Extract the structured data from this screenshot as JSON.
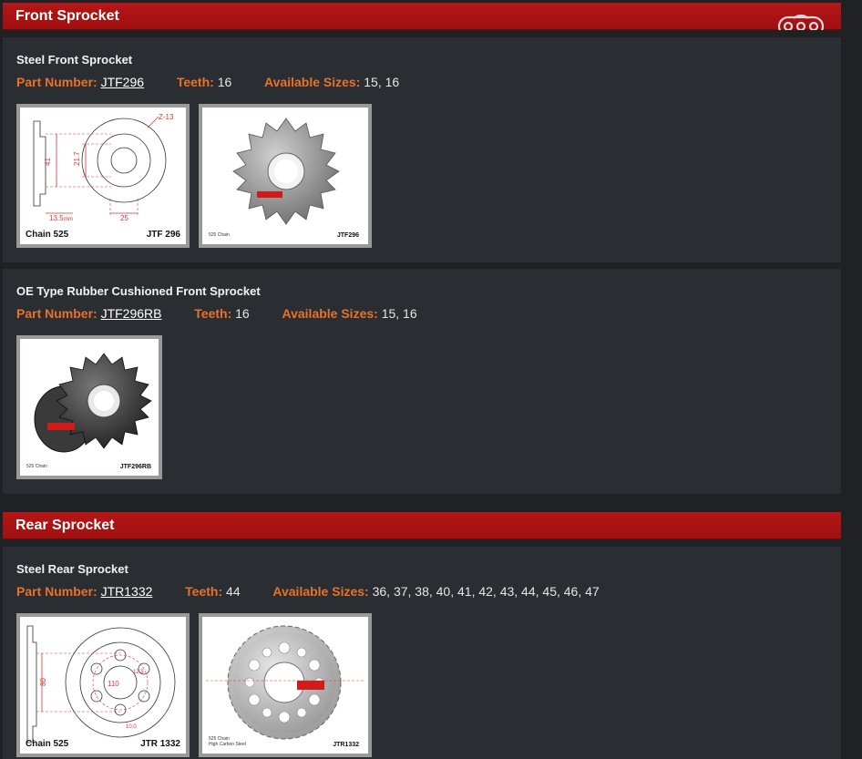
{
  "sections": {
    "front": {
      "title": "Front Sprocket",
      "products": [
        {
          "name": "Steel Front Sprocket",
          "part_label": "Part Number:",
          "part_number": "JTF296",
          "teeth_label": "Teeth:",
          "teeth": "16",
          "sizes_label": "Available Sizes:",
          "sizes": "15, 16",
          "diagram": {
            "chain": "Chain 525",
            "code": "JTF 296",
            "z": "Z-13",
            "d1": "41",
            "d2": "21.7",
            "d3": "13.5",
            "d4": "25",
            "unit": "mm"
          },
          "photo": {
            "chain": "525 Chain",
            "code": "JTF296"
          }
        },
        {
          "name": "OE Type Rubber Cushioned Front Sprocket",
          "part_label": "Part Number:",
          "part_number": "JTF296RB",
          "teeth_label": "Teeth:",
          "teeth": "16",
          "sizes_label": "Available Sizes:",
          "sizes": "15, 16",
          "photo": {
            "chain": "525 Chain",
            "code": "JTF296RB"
          }
        }
      ]
    },
    "rear": {
      "title": "Rear Sprocket",
      "products": [
        {
          "name": "Steel Rear Sprocket",
          "part_label": "Part Number:",
          "part_number": "JTR1332",
          "teeth_label": "Teeth:",
          "teeth": "44",
          "sizes_label": "Available Sizes:",
          "sizes": "36, 37, 38, 40, 41, 42, 43, 44, 45, 46, 47",
          "diagram": {
            "chain": "Chain 525",
            "code": "JTR 1332",
            "d1": "80",
            "d2": "110",
            "d3": "12.5",
            "d4": "10.0",
            "unit": "mm"
          },
          "photo": {
            "chain": "525 Chain",
            "material": "High Carbon Steel",
            "code": "JTR1332"
          }
        }
      ]
    }
  },
  "colors": {
    "accent_label": "#e8722a",
    "header_red": "#b51616",
    "brand_red": "#d11a1a"
  },
  "icons": {
    "header_icon": "chain-link-icon"
  }
}
